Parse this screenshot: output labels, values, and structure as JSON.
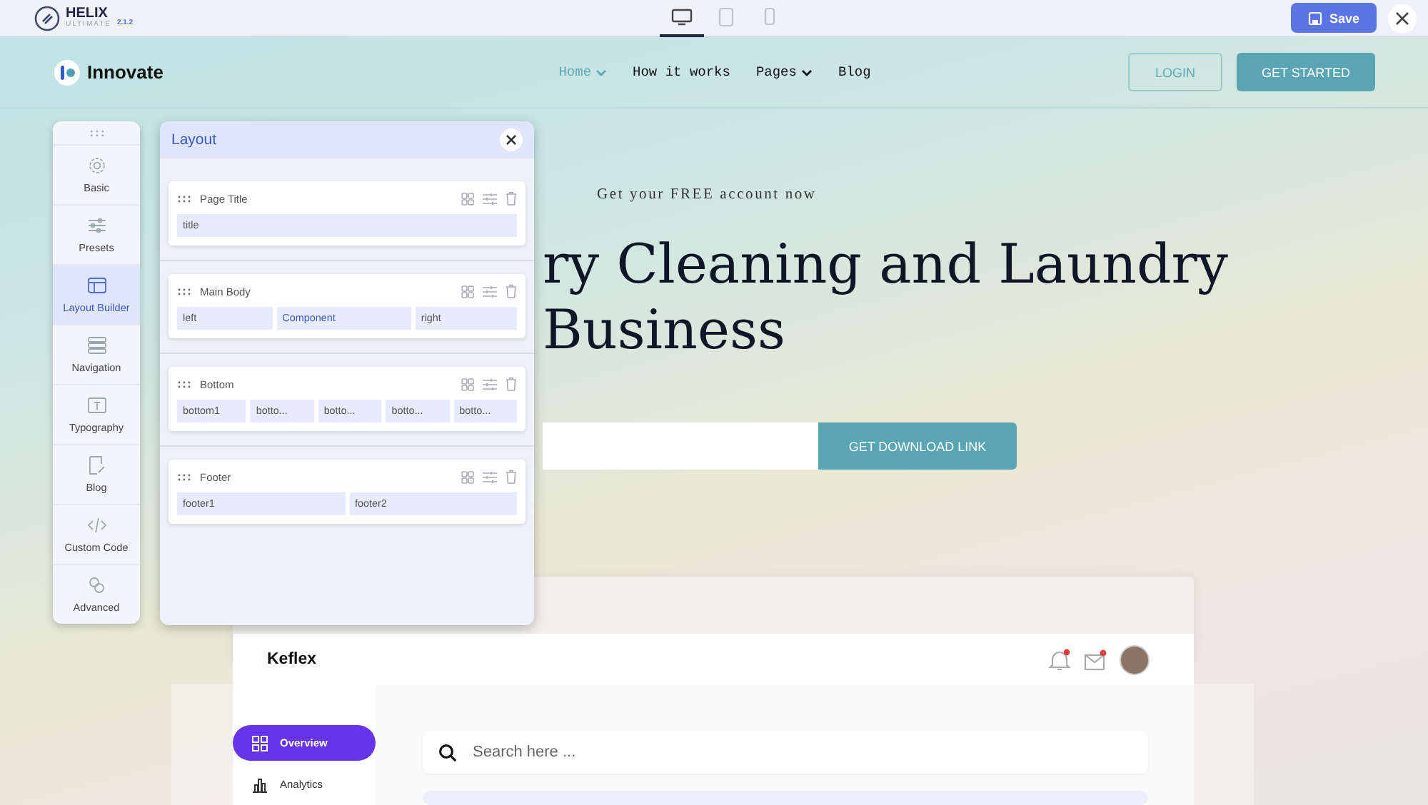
{
  "toolbar": {
    "logo": "HELIX",
    "logo_sub": "ULTIMATE",
    "version": "2.1.2",
    "devices": [
      {
        "selected": true
      },
      {
        "selected": false
      },
      {
        "selected": false
      }
    ],
    "save_button": "Save"
  },
  "site": {
    "brand": "Innovate",
    "nav": [
      {
        "label": "Home",
        "dropdown": true,
        "selected": true
      },
      {
        "label": "How it works",
        "dropdown": false,
        "selected": false
      },
      {
        "label": "Pages",
        "dropdown": true,
        "selected": false
      },
      {
        "label": "Blog",
        "dropdown": false,
        "selected": false
      }
    ],
    "login": "LOGIN",
    "cta": "GET STARTED"
  },
  "hero": {
    "eyebrow": "Get your FREE account now",
    "heading": "ry Cleaning and Laundry Business",
    "button": "GET DOWNLOAD LINK"
  },
  "sidebar": {
    "items": [
      {
        "label": "Basic",
        "selected": false
      },
      {
        "label": "Presets",
        "selected": false
      },
      {
        "label": "Layout Builder",
        "selected": true
      },
      {
        "label": "Navigation",
        "selected": false
      },
      {
        "label": "Typography",
        "selected": false
      },
      {
        "label": "Blog",
        "selected": false
      },
      {
        "label": "Custom Code",
        "selected": false
      },
      {
        "label": "Advanced",
        "selected": false
      }
    ]
  },
  "panel": {
    "title": "Layout",
    "rows": [
      {
        "title": "Page Title",
        "columns": [
          {
            "label": "title",
            "selected": false
          }
        ]
      },
      {
        "title": "Main Body",
        "columns": [
          {
            "label": "left",
            "selected": false
          },
          {
            "label": "Component",
            "selected": true
          },
          {
            "label": "right",
            "selected": false
          }
        ]
      },
      {
        "title": "Bottom",
        "columns": [
          {
            "label": "bottom1",
            "selected": false
          },
          {
            "label": "botto...",
            "selected": false
          },
          {
            "label": "botto...",
            "selected": false
          },
          {
            "label": "botto...",
            "selected": false
          },
          {
            "label": "botto...",
            "selected": false
          }
        ]
      },
      {
        "title": "Footer",
        "columns": [
          {
            "label": "footer1",
            "selected": false
          },
          {
            "label": "footer2",
            "selected": false
          }
        ]
      }
    ]
  },
  "preview": {
    "brand": "Keflex",
    "bell_unread": true,
    "mail_unread": true,
    "menu": [
      {
        "label": "Overview",
        "selected": true
      },
      {
        "label": "Analytics",
        "selected": false
      }
    ],
    "search": {
      "placeholder": "Search here ..."
    }
  }
}
